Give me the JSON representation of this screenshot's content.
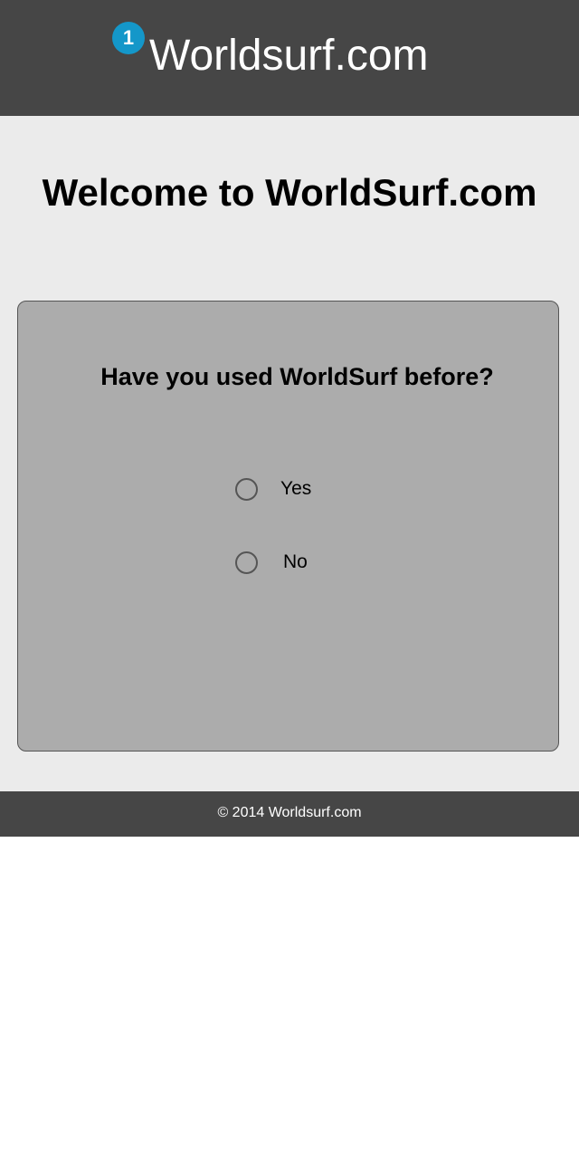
{
  "header": {
    "badge": "1",
    "site_title": "Worldsurf.com"
  },
  "main": {
    "welcome_heading": "Welcome to WorldSurf.com",
    "question": "Have you used WorldSurf before?",
    "options": [
      {
        "label": "Yes",
        "selected": false
      },
      {
        "label": "No",
        "selected": false
      }
    ]
  },
  "footer": {
    "copyright": "© 2014 Worldsurf.com"
  },
  "colors": {
    "header_bg": "#464646",
    "badge_bg": "#1497c9",
    "main_bg": "#ebebeb",
    "card_bg": "#acacac",
    "footer_bg": "#464646"
  }
}
